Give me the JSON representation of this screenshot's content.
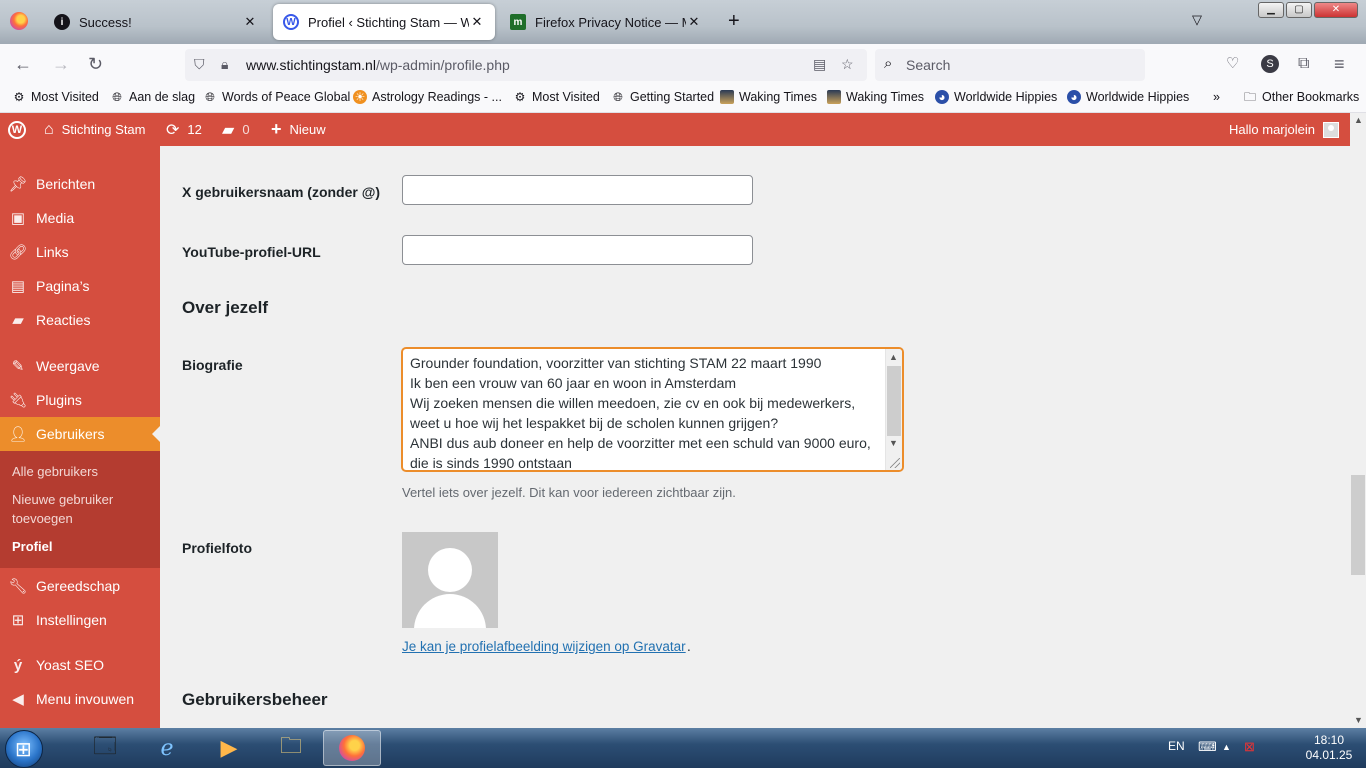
{
  "browser": {
    "tabs": [
      {
        "title": "Success!",
        "icon": "info-icon"
      },
      {
        "title": "Profiel ‹ Stichting Stam — WordPress",
        "icon": "wordpress-icon"
      },
      {
        "title": "Firefox Privacy Notice — Mozilla",
        "icon": "mozilla-icon"
      }
    ],
    "url_domain": "www.stichtingstam.nl",
    "url_path": "/wp-admin/profile.php",
    "search_placeholder": "Search",
    "profile_initial": "S",
    "bookmarks": [
      {
        "label": "Most Visited",
        "icon": "gear-icon"
      },
      {
        "label": "Aan de slag",
        "icon": "globe-icon"
      },
      {
        "label": "Words of Peace Global",
        "icon": "globe-icon"
      },
      {
        "label": "Astrology Readings - ...",
        "icon": "sun-icon"
      },
      {
        "label": "Most Visited",
        "icon": "gear-icon"
      },
      {
        "label": "Getting Started",
        "icon": "globe-icon"
      },
      {
        "label": "Waking Times",
        "icon": "photo-icon"
      },
      {
        "label": "Waking Times",
        "icon": "photo-icon"
      },
      {
        "label": "Worldwide Hippies",
        "icon": "earth-icon"
      },
      {
        "label": "Worldwide Hippies",
        "icon": "earth-icon"
      }
    ],
    "other_bookmarks": "Other Bookmarks"
  },
  "adminbar": {
    "site_name": "Stichting Stam",
    "updates_count": "12",
    "comments_count": "0",
    "new_label": "Nieuw",
    "greeting": "Hallo marjolein"
  },
  "menu": {
    "items": [
      {
        "label": "Berichten",
        "icon": "pin-icon"
      },
      {
        "label": "Media",
        "icon": "media-icon"
      },
      {
        "label": "Links",
        "icon": "link-icon"
      },
      {
        "label": "Pagina’s",
        "icon": "page-icon"
      },
      {
        "label": "Reacties",
        "icon": "comment-icon"
      },
      {
        "label": "Weergave",
        "icon": "brush-icon"
      },
      {
        "label": "Plugins",
        "icon": "plug-icon"
      },
      {
        "label": "Gebruikers",
        "icon": "users-icon"
      },
      {
        "label": "Gereedschap",
        "icon": "wrench-icon"
      },
      {
        "label": "Instellingen",
        "icon": "settings-icon"
      },
      {
        "label": "Yoast SEO",
        "icon": "yoast-icon"
      },
      {
        "label": "Menu invouwen",
        "icon": "collapse-icon"
      }
    ],
    "submenu": [
      {
        "label": "Alle gebruikers"
      },
      {
        "label": "Nieuwe gebruiker toevoegen"
      },
      {
        "label": "Profiel"
      }
    ]
  },
  "form": {
    "x_label": "X gebruikersnaam (zonder @)",
    "x_value": "",
    "youtube_label": "YouTube-profiel-URL",
    "youtube_value": "",
    "about_title": "Over jezelf",
    "bio_label": "Biografie",
    "bio_value": "Grounder foundation, voorzitter van stichting STAM 22 maart 1990\nIk ben een vrouw van 60 jaar en woon in Amsterdam\nWij zoeken mensen die willen meedoen, zie cv en ook bij medewerkers, weet u hoe wij het lespakket bij de scholen kunnen grijgen?\nANBI dus aub doneer en help de voorzitter met een schuld van 9000 euro, die is sinds 1990 ontstaan",
    "bio_description": "Vertel iets over jezelf. Dit kan voor iedereen zichtbaar zijn.",
    "photo_label": "Profielfoto",
    "gravatar_link": "Je kan je profielafbeelding wijzigen op Gravatar",
    "management_title": "Gebruikersbeheer"
  },
  "taskbar": {
    "language": "EN",
    "time": "18:10",
    "date": "04.01.25"
  },
  "colors": {
    "admin_accent": "#d54e3f",
    "menu_current": "#ec8d2b",
    "link": "#2271b1"
  }
}
